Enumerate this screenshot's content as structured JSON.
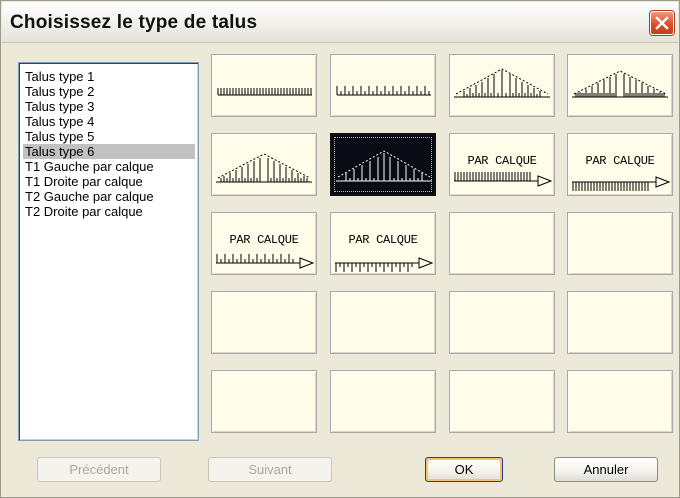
{
  "dialog": {
    "title": "Choisissez le type de talus"
  },
  "list": {
    "items": [
      "Talus type 1",
      "Talus type 2",
      "Talus type 3",
      "Talus type 4",
      "Talus type 5",
      "Talus type 6",
      "T1 Gauche par calque",
      "T1 Droite par calque",
      "T2 Gauche par calque",
      "T2 Droite par calque"
    ],
    "selected_index": 5
  },
  "tiles": [
    {
      "name": "Talus type 1",
      "glyph": "comb-dense"
    },
    {
      "name": "Talus type 2",
      "glyph": "comb-sparse"
    },
    {
      "name": "Talus type 3",
      "glyph": "roof-outline"
    },
    {
      "name": "Talus type 4",
      "glyph": "roof-dense"
    },
    {
      "name": "Talus type 5",
      "glyph": "roof-dense"
    },
    {
      "name": "Talus type 6",
      "glyph": "roof-selected",
      "selected": true
    },
    {
      "name": "T1 Gauche par calque",
      "label": "PAR CALQUE",
      "glyph": "arrow-comb-dense"
    },
    {
      "name": "T1 Droite par calque",
      "label": "PAR CALQUE",
      "glyph": "arrow-comb-thick"
    },
    {
      "name": "T2 Gauche par calque",
      "label": "PAR CALQUE",
      "glyph": "arrow-comb-sparse"
    },
    {
      "name": "T2 Droite par calque",
      "label": "PAR CALQUE",
      "glyph": "arrow-comb-hanging"
    }
  ],
  "buttons": {
    "previous": "Précédent",
    "next": "Suivant",
    "ok": "OK",
    "cancel": "Annuler"
  },
  "icons": {
    "close": "close-icon"
  },
  "colors": {
    "tile_background": "#fffcea",
    "selected_tile": "#0a0a14",
    "close_button": "#d9502a",
    "list_selection": "#c1c1c1"
  }
}
